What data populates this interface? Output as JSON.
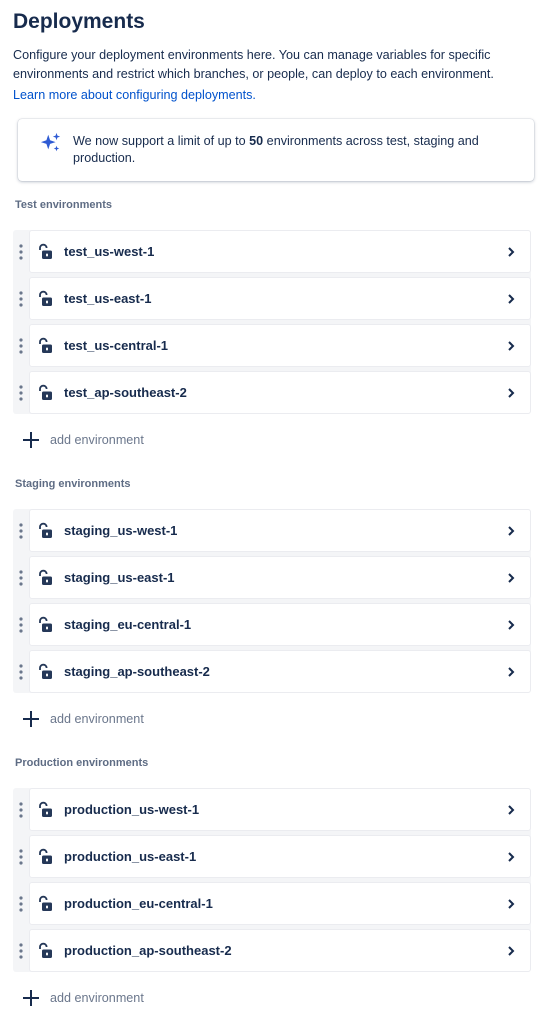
{
  "header": {
    "title": "Deployments",
    "description": "Configure your deployment environments here. You can manage variables for specific environments and restrict which branches, or people, can deploy to each environment.",
    "learn_more": "Learn more about configuring deployments."
  },
  "banner": {
    "icon": "sparkle-icon",
    "text_before": "We now support a limit of up to ",
    "text_bold": "50",
    "text_after": " environments across test, staging and production."
  },
  "sections": [
    {
      "title": "Test environments",
      "environments": [
        "test_us-west-1",
        "test_us-east-1",
        "test_us-central-1",
        "test_ap-southeast-2"
      ],
      "add_label": "add environment"
    },
    {
      "title": "Staging environments",
      "environments": [
        "staging_us-west-1",
        "staging_us-east-1",
        "staging_eu-central-1",
        "staging_ap-southeast-2"
      ],
      "add_label": "add environment"
    },
    {
      "title": "Production environments",
      "environments": [
        "production_us-west-1",
        "production_us-east-1",
        "production_eu-central-1",
        "production_ap-southeast-2"
      ],
      "add_label": "add environment"
    }
  ],
  "colors": {
    "text": "#172b4d",
    "link": "#0052cc",
    "muted": "#5e6c84",
    "sparkle": "#2f5bd3"
  }
}
